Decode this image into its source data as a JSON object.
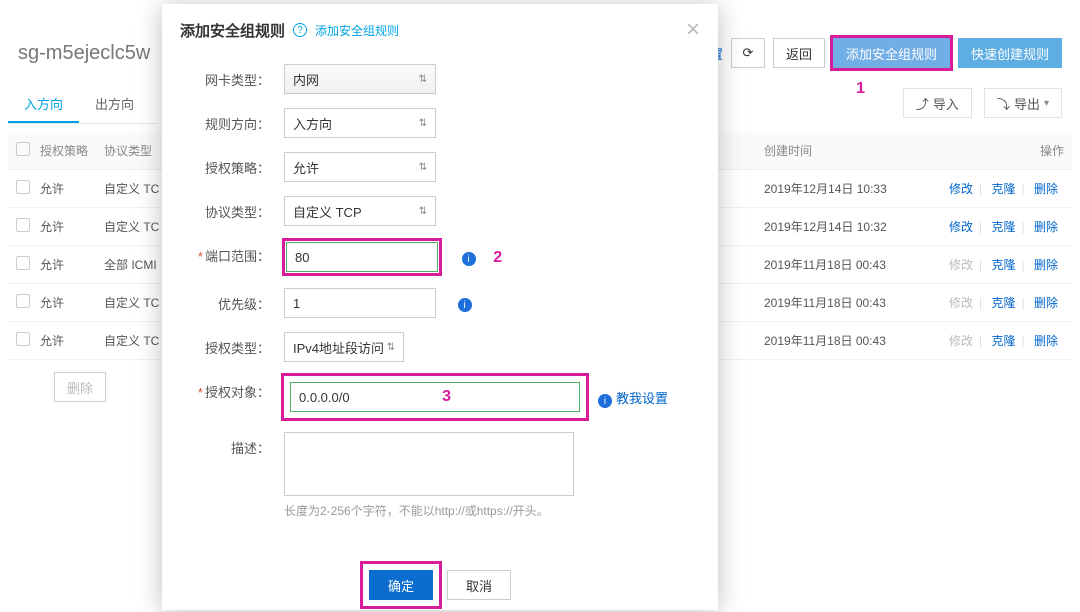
{
  "page": {
    "title": "sg-m5ejeclc5w"
  },
  "top_actions": {
    "my_settings": "我设置",
    "refresh_icon": "⟳",
    "back": "返回",
    "add_rule": "添加安全组规则",
    "quick_create": "快速创建规则"
  },
  "secondary_actions": {
    "import": "导入",
    "export": "导出",
    "import_icon": "⤴",
    "export_icon": "⤵"
  },
  "annotations": {
    "one": "1",
    "two": "2",
    "three": "3"
  },
  "tabs": {
    "in": "入方向",
    "out": "出方向"
  },
  "table": {
    "headers": {
      "policy": "授权策略",
      "protocol": "协议类型",
      "created": "创建时间",
      "ops": "操作"
    },
    "rows": [
      {
        "policy": "允许",
        "protocol": "自定义 TC",
        "created": "2019年12月14日 10:33",
        "modify_dim": false
      },
      {
        "policy": "允许",
        "protocol": "自定义 TC",
        "created": "2019年12月14日 10:32",
        "modify_dim": false
      },
      {
        "policy": "允许",
        "protocol": "全部 ICMI",
        "created": "2019年11月18日 00:43",
        "modify_dim": true
      },
      {
        "policy": "允许",
        "protocol": "自定义 TC",
        "created": "2019年11月18日 00:43",
        "modify_dim": true
      },
      {
        "policy": "允许",
        "protocol": "自定义 TC",
        "created": "2019年11月18日 00:43",
        "modify_dim": true
      }
    ],
    "ops": {
      "modify": "修改",
      "clone": "克隆",
      "delete": "删除"
    },
    "bulk_delete": "删除"
  },
  "modal": {
    "title": "添加安全组规则",
    "title_help": "添加安全组规则",
    "fields": {
      "nic_type": {
        "label": "网卡类型：",
        "value": "内网"
      },
      "direction": {
        "label": "规则方向：",
        "value": "入方向"
      },
      "policy": {
        "label": "授权策略：",
        "value": "允许"
      },
      "protocol": {
        "label": "协议类型：",
        "value": "自定义 TCP"
      },
      "port": {
        "label": "端口范围：",
        "value": "80",
        "required": true
      },
      "priority": {
        "label": "优先级：",
        "value": "1"
      },
      "auth_type": {
        "label": "授权类型：",
        "value": "IPv4地址段访问"
      },
      "auth_object": {
        "label": "授权对象：",
        "value": "0.0.0.0/0",
        "required": true,
        "teach": "教我设置"
      },
      "description": {
        "label": "描述：",
        "placeholder": "",
        "hint": "长度为2-256个字符，不能以http://或https://开头。"
      }
    },
    "buttons": {
      "ok": "确定",
      "cancel": "取消"
    }
  }
}
